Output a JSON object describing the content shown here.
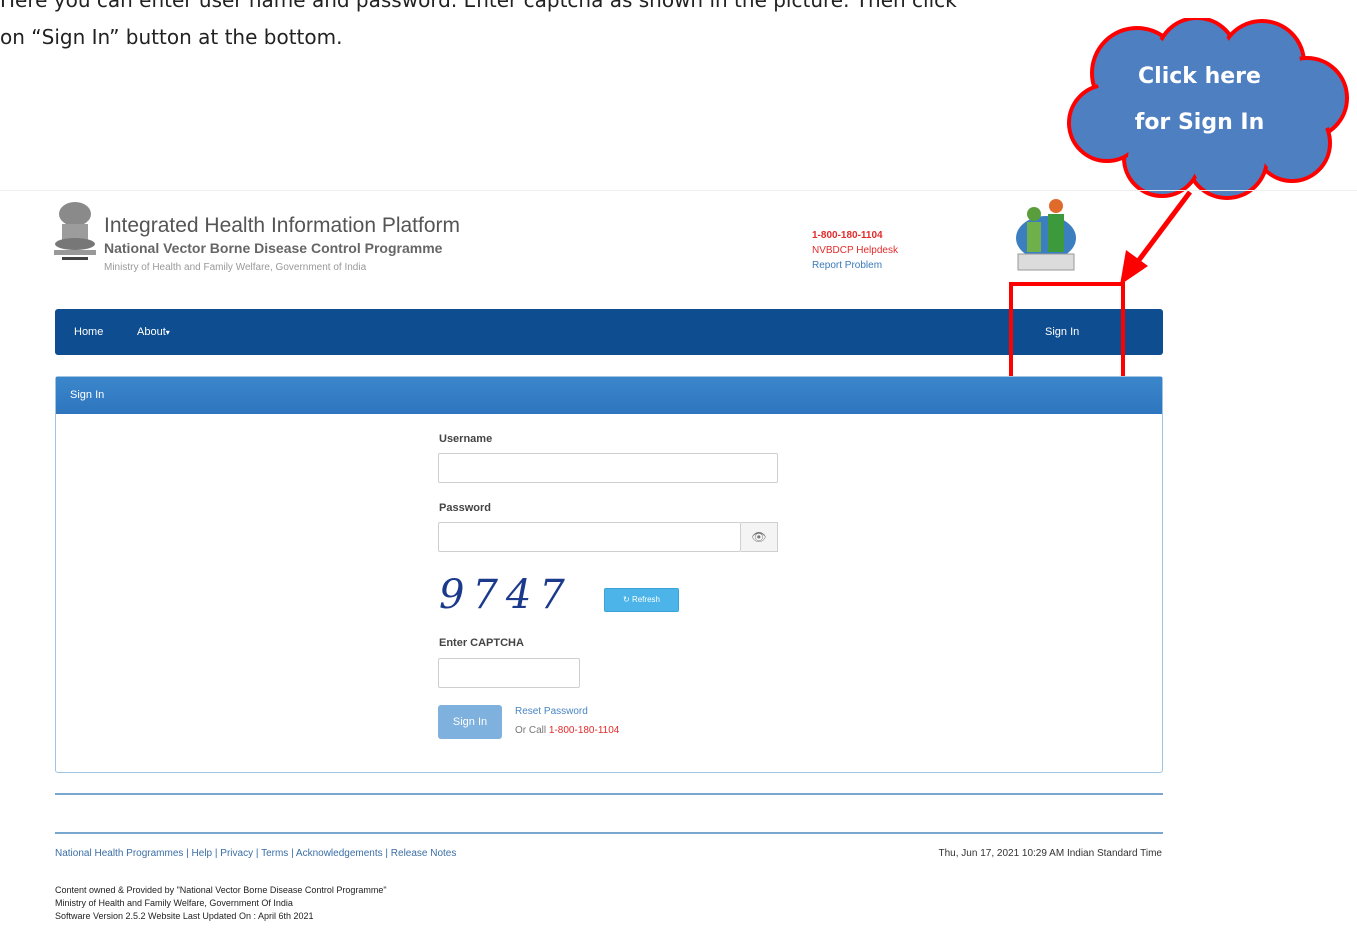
{
  "document": {
    "line1": "Here you can enter user name and password. Enter captcha as shown in the picture. Then click",
    "line2": "on “Sign In” button at the bottom."
  },
  "callout": {
    "line1": "Click here",
    "line2": "for Sign In",
    "cloud_color": "#4d7fc1",
    "border_color": "#ff0000"
  },
  "header": {
    "title": "Integrated Health Information Platform",
    "subtitle": "National Vector Borne Disease Control Programme",
    "ministry": "Ministry of Health and Family Welfare, Government of India",
    "helpline_phone": "1-800-180-1104",
    "helpdesk": "NVBDCP Helpdesk",
    "report": "Report Problem"
  },
  "navbar": {
    "home": "Home",
    "about": "About",
    "signin": "Sign In",
    "color": "#0e4d8f"
  },
  "panel": {
    "heading": "Sign In",
    "username_label": "Username",
    "password_label": "Password",
    "captcha_text": "9747",
    "refresh_label": "Refresh",
    "captcha_label": "Enter CAPTCHA",
    "signin_button": "Sign In",
    "reset_link": "Reset Password",
    "or_call": "Or Call",
    "call_number": "1-800-180-1104"
  },
  "footer": {
    "links": [
      "National Health Programmes",
      "Help",
      "Privacy",
      "Terms",
      "Acknowledgements",
      "Release Notes"
    ],
    "datetime": "Thu, Jun 17, 2021 10:29 AM Indian Standard Time",
    "info_line1": "Content owned & Provided by \"National Vector Borne Disease Control Programme\"",
    "info_line2": "Ministry of Health and Family Welfare, Government Of India",
    "info_line3": "Software Version 2.5.2  Website Last Updated On :  April 6th 2021"
  }
}
